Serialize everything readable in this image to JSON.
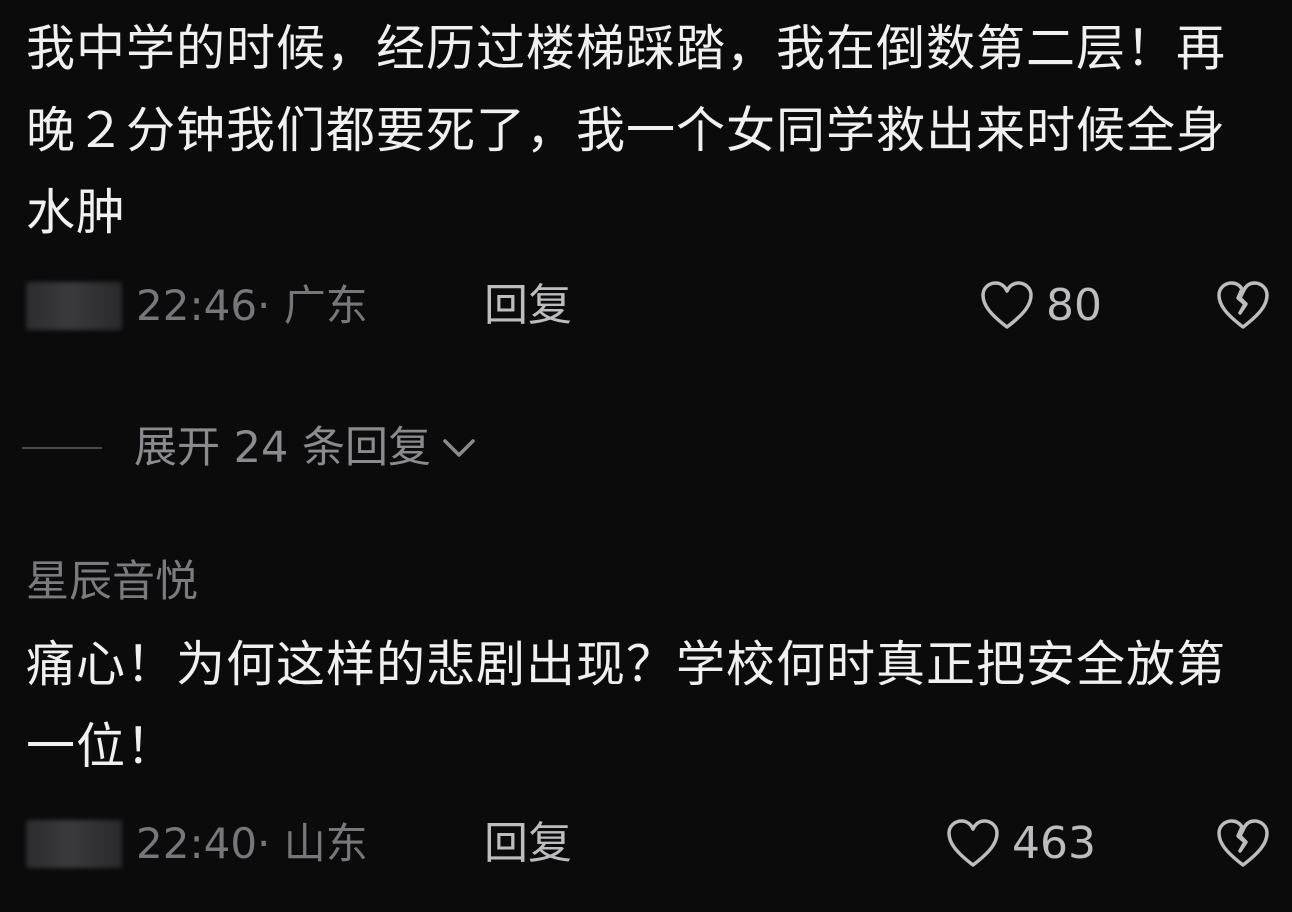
{
  "comments": [
    {
      "text": "我中学的时候，经历过楼梯踩踏，我在倒数第二层！再晚２分钟我们都要死了，我一个女同学救出来时候全身水肿",
      "time_location": "22:46· 广东",
      "reply_label": "回复",
      "like_count": "80",
      "icons": {
        "like": "heart-outline-icon",
        "dislike": "broken-heart-icon"
      }
    },
    {
      "username": "星辰音悦",
      "text": "痛心！为何这样的悲剧出现？学校何时真正把安全放第一位！",
      "time_location": "22:40· 山东",
      "reply_label": "回复",
      "like_count": "463",
      "icons": {
        "like": "heart-outline-icon",
        "dislike": "broken-heart-icon"
      }
    }
  ],
  "expand_replies": {
    "label": "展开 24 条回复",
    "icon": "chevron-down-icon"
  },
  "colors": {
    "background": "#0b0b0c",
    "primary_text": "#f0f0f0",
    "secondary_text": "#77777b",
    "action_text": "#bdbdc0"
  }
}
